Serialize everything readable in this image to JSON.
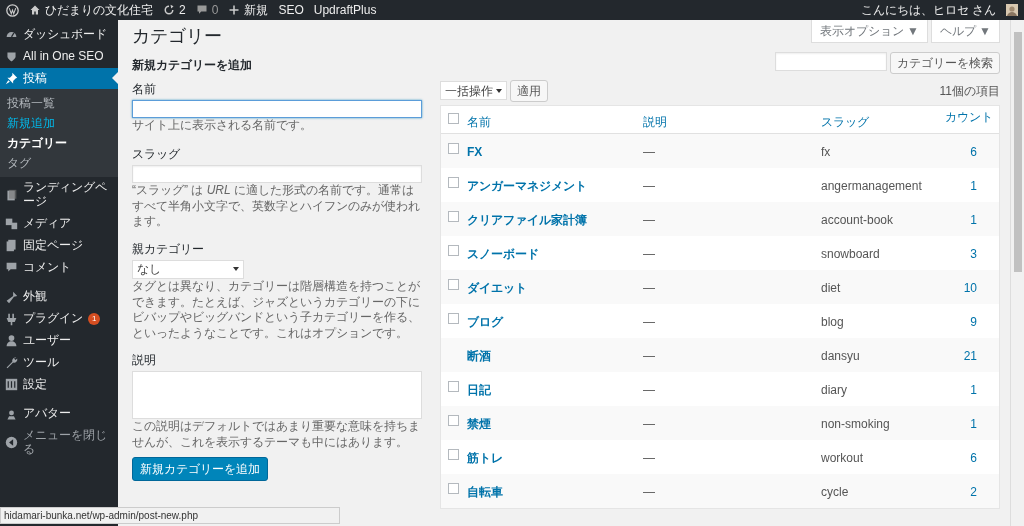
{
  "admin_bar": {
    "site_name": "ひだまりの文化住宅",
    "updates": "2",
    "comments": "0",
    "new": "新規",
    "links": [
      "SEO",
      "UpdraftPlus"
    ],
    "greeting": "こんにちは、ヒロセ さん"
  },
  "sidebar": {
    "items": [
      {
        "label": "ダッシュボード",
        "selected": false
      },
      {
        "label": "All in One SEO",
        "selected": false
      },
      {
        "label": "投稿",
        "selected": true,
        "children": [
          {
            "label": "投稿一覧",
            "selected": false,
            "hovered": false
          },
          {
            "label": "新規追加",
            "selected": false,
            "hovered": true
          },
          {
            "label": "カテゴリー",
            "selected": true,
            "hovered": false
          },
          {
            "label": "タグ",
            "selected": false,
            "hovered": false
          }
        ]
      },
      {
        "label": "ランディングページ",
        "selected": false
      },
      {
        "label": "メディア",
        "selected": false
      },
      {
        "label": "固定ページ",
        "selected": false
      },
      {
        "label": "コメント",
        "selected": false
      },
      {
        "label": "外観",
        "selected": false
      },
      {
        "label": "プラグイン",
        "selected": false,
        "badge": "1"
      },
      {
        "label": "ユーザー",
        "selected": false
      },
      {
        "label": "ツール",
        "selected": false
      },
      {
        "label": "設定",
        "selected": false
      },
      {
        "label": "アバター",
        "selected": false
      },
      {
        "label": "メニューを閉じる",
        "selected": false
      }
    ]
  },
  "screen_buttons": [
    "表示オプション ▼",
    "ヘルプ ▼"
  ],
  "page_title": "カテゴリー",
  "add_form": {
    "heading": "新規カテゴリーを追加",
    "name_label": "名前",
    "name_help": "サイト上に表示される名前です。",
    "slug_label": "スラッグ",
    "slug_help": "“スラッグ” は *URL* に適した形式の名前です。通常はすべて半角小文字で、英数字とハイフンのみが使われます。",
    "parent_label": "親カテゴリー",
    "parent_value": "なし",
    "parent_help": "タグとは異なり、カテゴリーは階層構造を持つことができます。たとえば、ジャズというカテゴリーの下にビバップやビッグバンドという子カテゴリーを作る、といったようなことです。これはオプションです。",
    "description_label": "説明",
    "description_help": "この説明はデフォルトではあまり重要な意味を持ちませんが、これを表示するテーマも中にはあります。",
    "submit": "新規カテゴリーを追加"
  },
  "search": {
    "button": "カテゴリーを検索"
  },
  "bulk_action": "一括操作",
  "apply": "適用",
  "item_count": "11個の項目",
  "table": {
    "columns": [
      "名前",
      "説明",
      "スラッグ",
      "カウント"
    ],
    "select_all_checked": false,
    "rows": [
      {
        "name": "FX",
        "description": "—",
        "slug": "fx",
        "count": "6",
        "has_checkbox": true,
        "checked": false
      },
      {
        "name": "アンガーマネジメント",
        "description": "—",
        "slug": "angermanagement",
        "count": "1",
        "has_checkbox": true,
        "checked": false
      },
      {
        "name": "クリアファイル家計簿",
        "description": "—",
        "slug": "account-book",
        "count": "1",
        "has_checkbox": true,
        "checked": false
      },
      {
        "name": "スノーボード",
        "description": "—",
        "slug": "snowboard",
        "count": "3",
        "has_checkbox": true,
        "checked": false
      },
      {
        "name": "ダイエット",
        "description": "—",
        "slug": "diet",
        "count": "10",
        "has_checkbox": true,
        "checked": false
      },
      {
        "name": "ブログ",
        "description": "—",
        "slug": "blog",
        "count": "9",
        "has_checkbox": true,
        "checked": false
      },
      {
        "name": "断酒",
        "description": "—",
        "slug": "dansyu",
        "count": "21",
        "has_checkbox": false
      },
      {
        "name": "日記",
        "description": "—",
        "slug": "diary",
        "count": "1",
        "has_checkbox": true,
        "checked": false
      },
      {
        "name": "禁煙",
        "description": "—",
        "slug": "non-smoking",
        "count": "1",
        "has_checkbox": true,
        "checked": false
      },
      {
        "name": "筋トレ",
        "description": "—",
        "slug": "workout",
        "count": "6",
        "has_checkbox": true,
        "checked": false
      },
      {
        "name": "自転車",
        "description": "—",
        "slug": "cycle",
        "count": "2",
        "has_checkbox": true,
        "checked": false
      }
    ]
  },
  "status_url": "hidamari-bunka.net/wp-admin/post-new.php"
}
